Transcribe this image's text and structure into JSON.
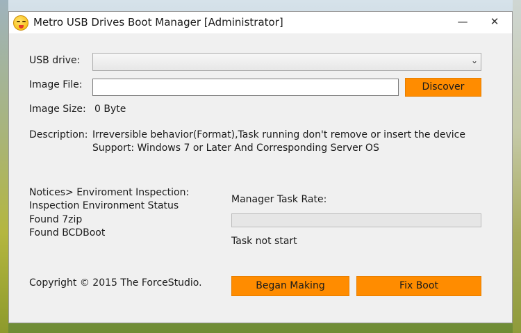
{
  "window": {
    "title": "Metro USB Drives Boot Manager [Administrator]",
    "minimize_glyph": "—",
    "close_glyph": "✕"
  },
  "form": {
    "usb_drive_label": "USB drive:",
    "usb_drive_value": "",
    "image_file_label": "Image File:",
    "image_file_value": "",
    "discover_label": "Discover",
    "image_size_label": "Image Size:",
    "image_size_value": "0 Byte",
    "description_label": "Description:",
    "description_lines": [
      "Irreversible behavior(Format),Task running don't remove or insert the device",
      "Support: Windows 7 or Later And Corresponding Server OS"
    ]
  },
  "notices": {
    "lines": [
      "Notices> Enviroment Inspection:",
      "Inspection Environment Status",
      "Found 7zip",
      "Found BCDBoot"
    ]
  },
  "task": {
    "rate_label": "Manager Task Rate:",
    "progress": 0,
    "status": "Task not start"
  },
  "footer": {
    "copyright": "Copyright © 2015 The ForceStudio.",
    "began_label": "Began Making",
    "fix_label": "Fix Boot"
  },
  "colors": {
    "accent": "#ff8c00",
    "window_bg": "#f0f0f0"
  },
  "icons": {
    "app": "smiley-tongue-icon",
    "dropdown": "chevron-down-icon"
  }
}
